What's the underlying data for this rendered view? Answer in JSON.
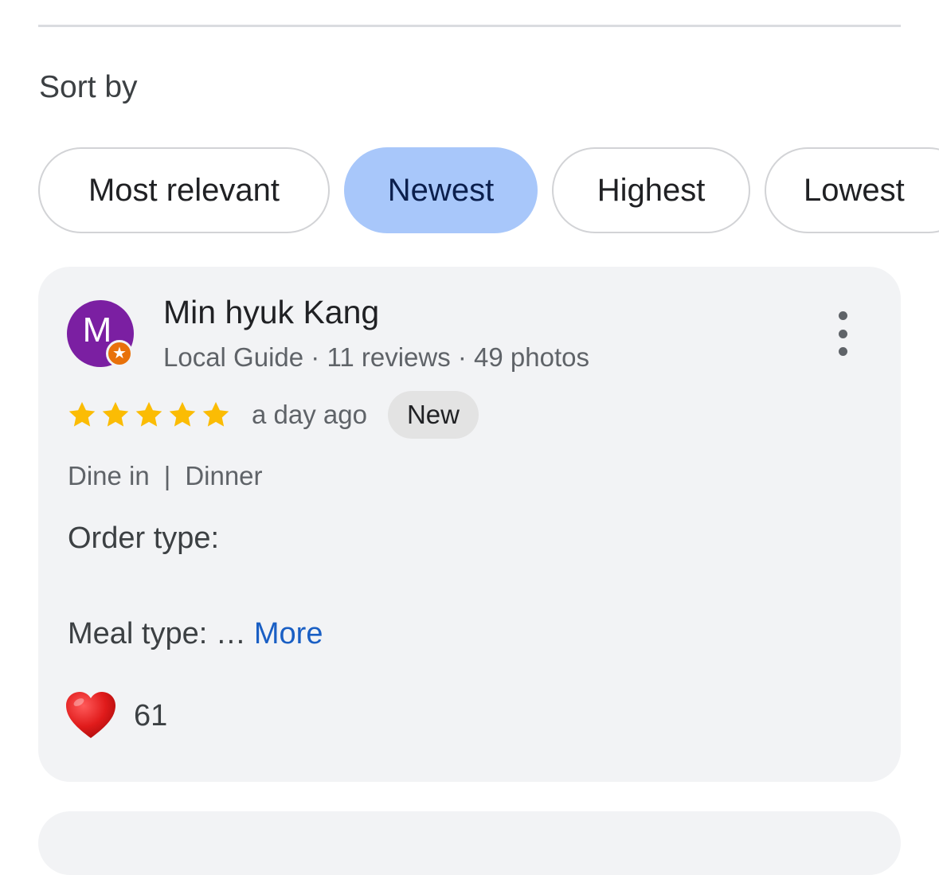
{
  "sort": {
    "label": "Sort by",
    "options": [
      {
        "label": "Most relevant",
        "selected": false
      },
      {
        "label": "Newest",
        "selected": true
      },
      {
        "label": "Highest",
        "selected": false
      },
      {
        "label": "Lowest",
        "selected": false
      }
    ]
  },
  "review": {
    "avatar_letter": "M",
    "avatar_color": "#7b1fa2",
    "badge_icon": "local-guide-star-icon",
    "badge_color": "#e8710a",
    "reviewer_name": "Min hyuk Kang",
    "reviewer_meta": "Local Guide · 11 reviews · 49 photos",
    "rating": 5,
    "rating_max": 5,
    "star_color": "#fbbc04",
    "time_ago": "a day ago",
    "new_badge": "New",
    "tags": [
      "Dine in",
      "Dinner"
    ],
    "tag_separator": "|",
    "order_type_label": "Order type:",
    "meal_type_label": "Meal type: …",
    "more_link": "More",
    "reaction_icon": "heart-icon",
    "reaction_count": "61"
  },
  "colors": {
    "selected_chip_bg": "#a8c7fa",
    "card_bg": "#f2f3f5",
    "link": "#1a5fc4"
  }
}
